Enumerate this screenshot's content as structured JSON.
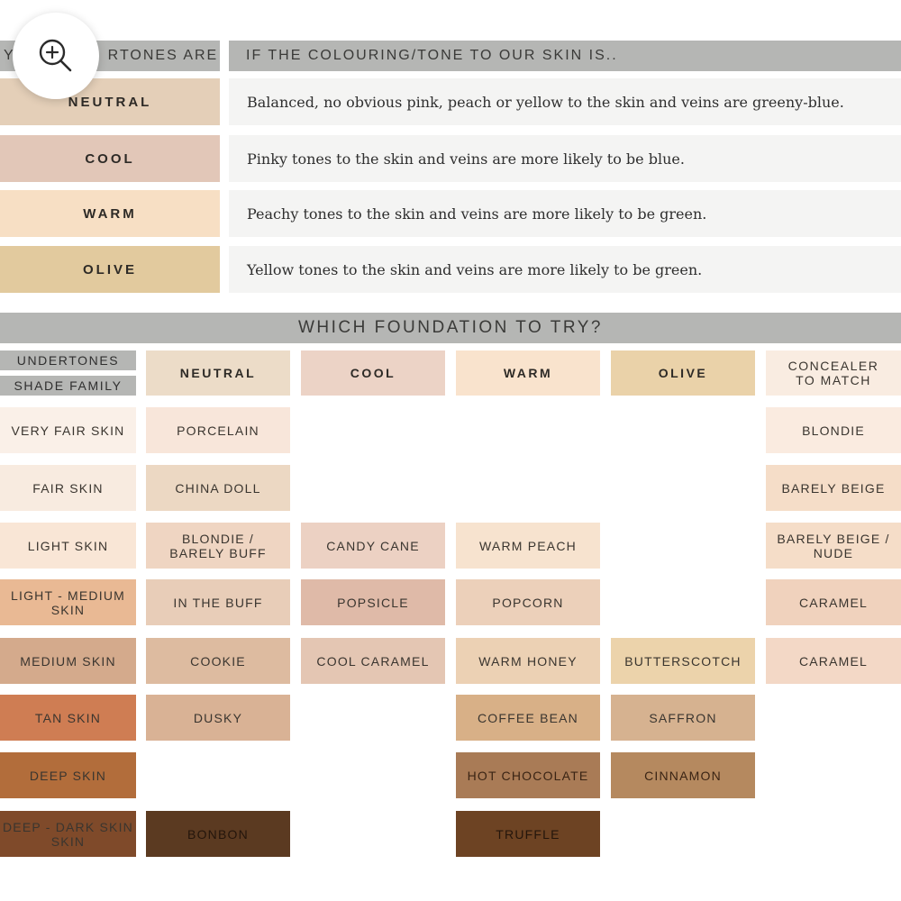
{
  "top_header": {
    "left_prefix": "Y",
    "left_suffix": "RTONES ARE",
    "right": "IF THE COLOURING/TONE TO OUR SKIN IS.."
  },
  "undertones": [
    {
      "label": "NEUTRAL",
      "color": "#e4cfb8",
      "description": "Balanced, no obvious pink, peach or yellow to the skin and veins are greeny-blue."
    },
    {
      "label": "COOL",
      "color": "#e2c7b8",
      "description": "Pinky tones to the skin and veins are more likely to be blue."
    },
    {
      "label": "WARM",
      "color": "#f7dfc4",
      "description": "Peachy tones to the skin and veins are more likely to be green."
    },
    {
      "label": "OLIVE",
      "color": "#e2ca9e",
      "description": "Yellow tones to the skin and veins are more likely to be green."
    }
  ],
  "section_title": "WHICH FOUNDATION TO TRY?",
  "grid": {
    "corner_top": "UNDERTONES",
    "corner_bottom": "SHADE FAMILY",
    "columns": [
      {
        "label": "NEUTRAL",
        "color": "#ecdcc8"
      },
      {
        "label": "COOL",
        "color": "#ecd3c6"
      },
      {
        "label": "WARM",
        "color": "#f9e3cd"
      },
      {
        "label": "OLIVE",
        "color": "#ead2a9"
      },
      {
        "label": "CONCEALER\nTO MATCH",
        "color": "#f9ece1"
      }
    ],
    "rows": [
      {
        "shade": "VERY FAIR SKIN",
        "color": "#faf0e8",
        "cells": [
          "PORCELAIN",
          "",
          "",
          "",
          "BLONDIE"
        ]
      },
      {
        "shade": "FAIR SKIN",
        "color": "#f8ebe0",
        "cells": [
          "CHINA DOLL",
          "",
          "",
          "",
          "BARELY BEIGE"
        ]
      },
      {
        "shade": "LIGHT SKIN",
        "color": "#f9e6d6",
        "cells": [
          "BLONDIE /\nBARELY BUFF",
          "CANDY CANE",
          "WARM PEACH",
          "",
          "BARELY BEIGE /\nNUDE"
        ]
      },
      {
        "shade": "LIGHT - MEDIUM\nSKIN",
        "color": "#e9b994",
        "cells": [
          "IN THE BUFF",
          "POPSICLE",
          "POPCORN",
          "",
          "CARAMEL"
        ]
      },
      {
        "shade": "MEDIUM SKIN",
        "color": "#d4aa8c",
        "cells": [
          "COOKIE",
          "COOL CARAMEL",
          "WARM HONEY",
          "BUTTERSCOTCH",
          "CARAMEL"
        ]
      },
      {
        "shade": "TAN SKIN",
        "color": "#cf7d53",
        "cells": [
          "DUSKY",
          "",
          "COFFEE BEAN",
          "SAFFRON",
          ""
        ]
      },
      {
        "shade": "DEEP SKIN",
        "color": "#b26d3b",
        "cells": [
          "",
          "",
          "HOT CHOCOLATE",
          "CINNAMON",
          ""
        ]
      },
      {
        "shade": "DEEP - DARK SKIN\nSKIN",
        "color": "#7f4a2a",
        "cells": [
          "BONBON",
          "",
          "TRUFFLE",
          "",
          ""
        ]
      }
    ],
    "cell_colors": [
      [
        "#f8e6da",
        null,
        null,
        null,
        "#faebe0"
      ],
      [
        "#ecd8c3",
        null,
        null,
        null,
        "#f5ddc8"
      ],
      [
        "#efd5c2",
        "#ecd1c3",
        "#f7e3cf",
        null,
        "#f5ddc8"
      ],
      [
        "#e8cdb8",
        "#dfbaa8",
        "#ecd0ba",
        null,
        "#f0d2bd"
      ],
      [
        "#ddbba0",
        "#e4c6b3",
        "#ecd1b4",
        "#ecd3ab",
        "#f3d8c6"
      ],
      [
        "#d9b295",
        null,
        "#d8b087",
        "#d6b290",
        null
      ],
      [
        null,
        null,
        "#a97b56",
        "#b5895f",
        null
      ],
      [
        "#5b3a21",
        null,
        "#6d4323",
        null,
        null
      ]
    ]
  },
  "zoom_icon": "zoom-in-icon"
}
